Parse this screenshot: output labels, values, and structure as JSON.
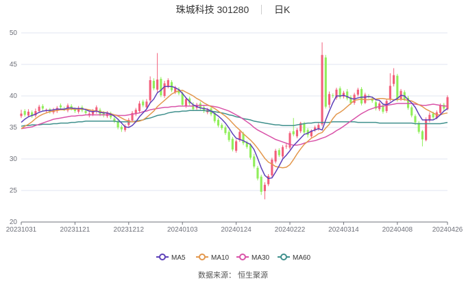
{
  "title": {
    "stock_name": "珠城科技 301280",
    "period": "日K"
  },
  "source_text": "数据来源： 恒生聚源",
  "colors": {
    "up": "#f25f7b",
    "down": "#90ee5a",
    "ma5": "#5c3fb8",
    "ma10": "#e3974c",
    "ma30": "#d952a8",
    "ma60": "#3e8f8c",
    "grid": "#e0e6f1"
  },
  "chart_data": {
    "type": "candlestick",
    "ylim": [
      20,
      50
    ],
    "y_ticks": [
      "20",
      "25",
      "30",
      "35",
      "40",
      "45",
      "50"
    ],
    "x_ticks": [
      {
        "label": "20231031",
        "index": 0
      },
      {
        "label": "20231121",
        "index": 15
      },
      {
        "label": "20231212",
        "index": 30
      },
      {
        "label": "20240103",
        "index": 45
      },
      {
        "label": "20240124",
        "index": 60
      },
      {
        "label": "20240222",
        "index": 75
      },
      {
        "label": "20240314",
        "index": 90
      },
      {
        "label": "20240408",
        "index": 105
      },
      {
        "label": "20240426",
        "index": 119
      }
    ],
    "legend": [
      {
        "name": "MA5",
        "color_key": "ma5"
      },
      {
        "name": "MA10",
        "color_key": "ma10"
      },
      {
        "name": "MA30",
        "color_key": "ma30"
      },
      {
        "name": "MA60",
        "color_key": "ma60"
      }
    ],
    "closes": [
      37.2,
      37.0,
      37.5,
      36.8,
      37.6,
      38.3,
      38.0,
      37.8,
      37.5,
      37.8,
      38.1,
      38.2,
      37.9,
      38.5,
      38.0,
      37.6,
      38.1,
      37.7,
      37.3,
      37.2,
      37.6,
      38.2,
      37.1,
      36.9,
      37.3,
      36.6,
      35.9,
      35.0,
      34.7,
      35.2,
      36.2,
      37.3,
      37.8,
      38.8,
      38.5,
      39.1,
      42.5,
      41.2,
      42.6,
      40.1,
      42.0,
      42.5,
      40.9,
      41.3,
      40.4,
      38.6,
      39.5,
      38.8,
      37.9,
      38.6,
      38.1,
      37.6,
      37.8,
      37.1,
      36.0,
      35.3,
      34.9,
      34.1,
      33.0,
      31.5,
      32.8,
      34.3,
      32.5,
      31.9,
      30.2,
      28.8,
      26.9,
      24.8,
      25.9,
      27.3,
      29.9,
      31.3,
      30.6,
      31.9,
      32.1,
      34.1,
      33.9,
      34.6,
      35.7,
      34.2,
      33.8,
      34.5,
      35.0,
      35.4,
      46.5,
      38.3,
      40.3,
      40.0,
      41.0,
      39.8,
      40.5,
      39.6,
      38.9,
      40.2,
      41.0,
      38.8,
      40.2,
      39.9,
      39.2,
      38.0,
      38.8,
      37.5,
      39.2,
      41.6,
      43.3,
      39.4,
      40.8,
      39.5,
      38.1,
      36.9,
      35.8,
      34.3,
      33.1,
      36.3,
      37.0,
      36.6,
      37.4,
      38.5,
      38.0,
      39.8
    ],
    "opens": [
      36.8,
      37.6,
      36.9,
      37.4,
      36.9,
      37.6,
      38.4,
      37.6,
      37.9,
      37.4,
      37.6,
      38.5,
      38.0,
      37.7,
      38.4,
      37.9,
      37.5,
      38.2,
      37.6,
      36.9,
      37.1,
      37.5,
      37.8,
      37.3,
      36.8,
      37.2,
      36.4,
      36.0,
      35.1,
      34.6,
      35.4,
      36.1,
      37.1,
      37.6,
      39.1,
      38.2,
      39.3,
      42.4,
      41.0,
      42.7,
      40.0,
      41.5,
      42.2,
      40.6,
      41.1,
      40.4,
      38.4,
      39.6,
      38.6,
      38.1,
      38.8,
      38.2,
      37.4,
      38.0,
      37.3,
      36.2,
      35.4,
      35.0,
      34.3,
      33.2,
      31.3,
      33.0,
      34.0,
      32.6,
      32.2,
      30.4,
      28.6,
      27.2,
      24.9,
      26.0,
      27.4,
      29.6,
      31.4,
      30.4,
      32.1,
      31.8,
      34.4,
      33.6,
      34.4,
      35.6,
      34.6,
      33.6,
      34.6,
      34.8,
      35.5,
      46.1,
      38.6,
      40.1,
      39.7,
      41.2,
      39.9,
      40.7,
      39.8,
      38.9,
      40.2,
      41.1,
      38.9,
      40.0,
      39.6,
      39.0,
      37.9,
      38.5,
      37.6,
      39.4,
      41.9,
      43.2,
      39.5,
      40.6,
      39.7,
      38.2,
      36.8,
      35.7,
      34.4,
      33.0,
      36.1,
      37.2,
      36.5,
      37.3,
      38.6,
      37.9
    ],
    "highs": [
      37.8,
      37.9,
      37.9,
      37.7,
      38.0,
      38.6,
      38.7,
      38.0,
      38.1,
      38.1,
      38.4,
      38.8,
      38.3,
      38.8,
      38.7,
      38.2,
      38.4,
      38.5,
      37.9,
      37.5,
      37.9,
      38.5,
      38.1,
      37.6,
      37.6,
      37.5,
      36.7,
      36.3,
      35.4,
      35.5,
      36.5,
      37.6,
      38.1,
      39.2,
      39.4,
      39.5,
      43.1,
      42.8,
      46.8,
      43.0,
      42.4,
      42.8,
      42.5,
      41.6,
      41.4,
      40.7,
      39.8,
      39.9,
      39.0,
      38.9,
      39.1,
      38.5,
      38.1,
      38.3,
      37.6,
      36.5,
      35.7,
      35.3,
      34.6,
      33.5,
      33.1,
      34.6,
      34.3,
      32.9,
      32.5,
      30.8,
      28.9,
      27.5,
      26.3,
      27.6,
      30.2,
      31.6,
      31.7,
      32.2,
      32.4,
      34.4,
      36.5,
      34.9,
      35.9,
      35.9,
      34.9,
      34.7,
      35.3,
      35.7,
      48.5,
      46.5,
      40.7,
      40.4,
      41.3,
      41.5,
      40.8,
      41.1,
      40.1,
      40.5,
      41.3,
      41.4,
      40.5,
      40.3,
      39.9,
      39.3,
      39.1,
      38.8,
      39.5,
      43.6,
      44.4,
      43.5,
      41.1,
      40.9,
      40.0,
      38.5,
      37.1,
      36.0,
      34.6,
      36.6,
      37.4,
      37.5,
      37.7,
      38.8,
      38.9,
      40.1
    ],
    "lows": [
      36.5,
      36.7,
      36.6,
      36.5,
      36.6,
      37.3,
      37.6,
      37.3,
      37.2,
      37.1,
      37.3,
      37.9,
      37.6,
      37.4,
      37.7,
      37.3,
      37.2,
      37.4,
      37.0,
      36.6,
      36.8,
      37.2,
      36.8,
      36.6,
      36.5,
      36.3,
      35.7,
      34.7,
      34.3,
      34.3,
      35.1,
      35.8,
      36.8,
      37.3,
      38.2,
      37.9,
      38.9,
      40.9,
      40.6,
      39.8,
      39.7,
      41.2,
      40.6,
      40.3,
      40.1,
      38.3,
      38.1,
      38.5,
      37.6,
      37.8,
      37.8,
      37.3,
      37.1,
      36.8,
      35.7,
      35.0,
      34.6,
      33.8,
      32.7,
      31.2,
      31.0,
      32.7,
      32.2,
      31.6,
      29.9,
      28.5,
      26.6,
      24.3,
      23.6,
      25.7,
      27.1,
      29.3,
      30.3,
      30.1,
      31.6,
      31.5,
      33.6,
      33.3,
      34.1,
      33.9,
      33.4,
      33.3,
      34.3,
      34.5,
      35.2,
      38.0,
      38.1,
      39.7,
      39.4,
      39.5,
      39.6,
      39.3,
      38.6,
      38.6,
      39.9,
      38.5,
      38.7,
      39.6,
      38.9,
      37.7,
      37.6,
      37.2,
      37.3,
      39.1,
      41.5,
      39.1,
      39.2,
      39.2,
      37.8,
      36.6,
      35.4,
      34.0,
      32.0,
      32.8,
      35.8,
      36.3,
      36.3,
      37.0,
      37.6,
      37.7
    ],
    "ma5": [
      35.8,
      36.3,
      36.7,
      36.9,
      37.1,
      37.4,
      37.6,
      37.7,
      37.7,
      37.8,
      37.9,
      37.9,
      37.9,
      38.1,
      38.1,
      38.0,
      38.0,
      38.0,
      37.8,
      37.6,
      37.5,
      37.6,
      37.4,
      37.3,
      37.3,
      37.1,
      36.8,
      36.3,
      35.7,
      35.1,
      35.0,
      35.3,
      35.9,
      36.7,
      37.3,
      37.9,
      38.9,
      39.5,
      40.5,
      40.9,
      41.5,
      41.5,
      41.5,
      41.3,
      41.0,
      40.4,
      39.7,
      39.1,
      38.6,
      38.3,
      38.1,
      38.0,
      37.9,
      37.6,
      37.2,
      36.8,
      36.3,
      35.7,
      34.9,
      34.0,
      33.3,
      33.1,
      32.9,
      32.6,
      32.3,
      31.5,
      30.1,
      28.6,
      27.4,
      26.9,
      27.0,
      27.9,
      28.9,
      30.0,
      30.6,
      31.3,
      32.1,
      32.7,
      33.3,
      33.9,
      34.1,
      34.4,
      34.6,
      34.8,
      34.6,
      36.2,
      37.6,
      38.9,
      40.0,
      40.0,
      40.1,
      39.9,
      39.6,
      39.5,
      39.7,
      39.8,
      39.8,
      39.9,
      39.8,
      39.4,
      39.3,
      38.7,
      38.6,
      38.9,
      39.3,
      39.6,
      40.1,
      40.0,
      39.4,
      38.9,
      38.2,
      37.1,
      36.2,
      36.2,
      36.2,
      36.2,
      36.5,
      37.0,
      37.6,
      38.0
    ],
    "ma10": [
      34.8,
      35.2,
      35.5,
      35.9,
      36.4,
      36.8,
      37.1,
      37.3,
      37.5,
      37.6,
      37.7,
      37.8,
      37.8,
      37.9,
      37.9,
      37.9,
      37.9,
      37.9,
      37.9,
      37.8,
      37.7,
      37.6,
      37.5,
      37.4,
      37.3,
      37.2,
      37.0,
      36.8,
      36.5,
      36.2,
      36.0,
      35.9,
      35.9,
      36.0,
      36.2,
      36.6,
      37.1,
      37.6,
      38.3,
      38.8,
      39.3,
      39.8,
      40.3,
      40.6,
      40.8,
      40.9,
      40.6,
      40.3,
      40.0,
      39.6,
      39.3,
      38.9,
      38.6,
      38.3,
      38.0,
      37.6,
      37.2,
      36.8,
      36.3,
      35.7,
      35.1,
      34.6,
      34.0,
      33.5,
      33.0,
      32.4,
      31.7,
      30.9,
      30.1,
      29.5,
      29.2,
      28.8,
      28.7,
      28.6,
      28.7,
      29.1,
      29.9,
      30.8,
      31.6,
      32.3,
      32.8,
      33.3,
      33.6,
      34.0,
      34.2,
      34.9,
      35.5,
      36.4,
      37.1,
      37.4,
      37.8,
      38.3,
      38.8,
      39.3,
      39.4,
      39.5,
      39.4,
      39.4,
      39.5,
      39.5,
      39.6,
      39.6,
      39.5,
      39.5,
      39.4,
      39.4,
      39.5,
      39.4,
      39.3,
      39.2,
      38.9,
      38.6,
      38.3,
      37.9,
      37.6,
      37.3,
      37.0,
      37.0,
      37.2,
      37.3
    ],
    "ma30": [
      34.8,
      34.9,
      35.0,
      35.1,
      35.3,
      35.5,
      35.7,
      35.9,
      36.1,
      36.3,
      36.4,
      36.5,
      36.6,
      36.7,
      36.8,
      36.8,
      36.9,
      36.9,
      37.0,
      37.0,
      37.0,
      37.0,
      37.0,
      37.0,
      37.0,
      37.0,
      37.0,
      36.9,
      36.9,
      36.9,
      37.0,
      37.1,
      37.2,
      37.3,
      37.5,
      37.6,
      37.8,
      37.9,
      38.0,
      38.1,
      38.2,
      38.2,
      38.3,
      38.3,
      38.4,
      38.4,
      38.4,
      38.4,
      38.4,
      38.5,
      38.5,
      38.5,
      38.5,
      38.4,
      38.3,
      38.2,
      38.0,
      37.8,
      37.6,
      37.3,
      37.0,
      36.7,
      36.3,
      35.9,
      35.5,
      35.0,
      34.6,
      34.3,
      34.0,
      33.7,
      33.4,
      33.1,
      32.9,
      32.7,
      32.5,
      32.3,
      32.2,
      32.2,
      32.3,
      32.5,
      32.7,
      32.8,
      32.9,
      33.1,
      33.3,
      33.5,
      33.8,
      34.1,
      34.5,
      34.8,
      35.2,
      35.6,
      36.0,
      36.4,
      36.8,
      37.2,
      37.5,
      37.8,
      38.0,
      38.2,
      38.3,
      38.4,
      38.5,
      38.6,
      38.7,
      38.8,
      38.8,
      38.8,
      38.8,
      38.8,
      38.7,
      38.6,
      38.5,
      38.5,
      38.6,
      38.7,
      38.6,
      38.5,
      38.4,
      38.4
    ],
    "ma60": [
      35.2,
      35.3,
      35.3,
      35.4,
      35.4,
      35.4,
      35.5,
      35.5,
      35.5,
      35.6,
      35.6,
      35.7,
      35.7,
      35.7,
      35.8,
      35.8,
      35.9,
      35.9,
      36.0,
      36.0,
      36.0,
      36.0,
      36.0,
      36.0,
      36.0,
      36.0,
      36.0,
      35.9,
      35.9,
      35.9,
      35.9,
      35.9,
      36.0,
      36.1,
      36.2,
      36.4,
      36.5,
      36.7,
      36.9,
      37.0,
      37.1,
      37.3,
      37.4,
      37.5,
      37.5,
      37.6,
      37.6,
      37.7,
      37.7,
      37.7,
      37.7,
      37.7,
      37.6,
      37.6,
      37.5,
      37.4,
      37.3,
      37.2,
      37.0,
      36.9,
      36.7,
      36.6,
      36.4,
      36.3,
      36.2,
      36.0,
      35.9,
      35.8,
      35.7,
      35.6,
      35.5,
      35.4,
      35.4,
      35.3,
      35.3,
      35.3,
      35.3,
      35.4,
      35.5,
      35.6,
      35.7,
      35.7,
      35.8,
      35.8,
      35.8,
      35.8,
      35.8,
      35.9,
      35.9,
      35.9,
      35.9,
      35.9,
      35.9,
      35.9,
      35.8,
      35.8,
      35.8,
      35.8,
      35.8,
      35.8,
      35.7,
      35.7,
      35.7,
      35.7,
      35.7,
      35.7,
      35.7,
      35.7,
      35.7,
      35.7,
      35.6,
      35.6,
      35.6,
      35.6,
      35.6,
      35.6,
      35.6,
      35.6,
      35.7,
      35.8
    ]
  }
}
